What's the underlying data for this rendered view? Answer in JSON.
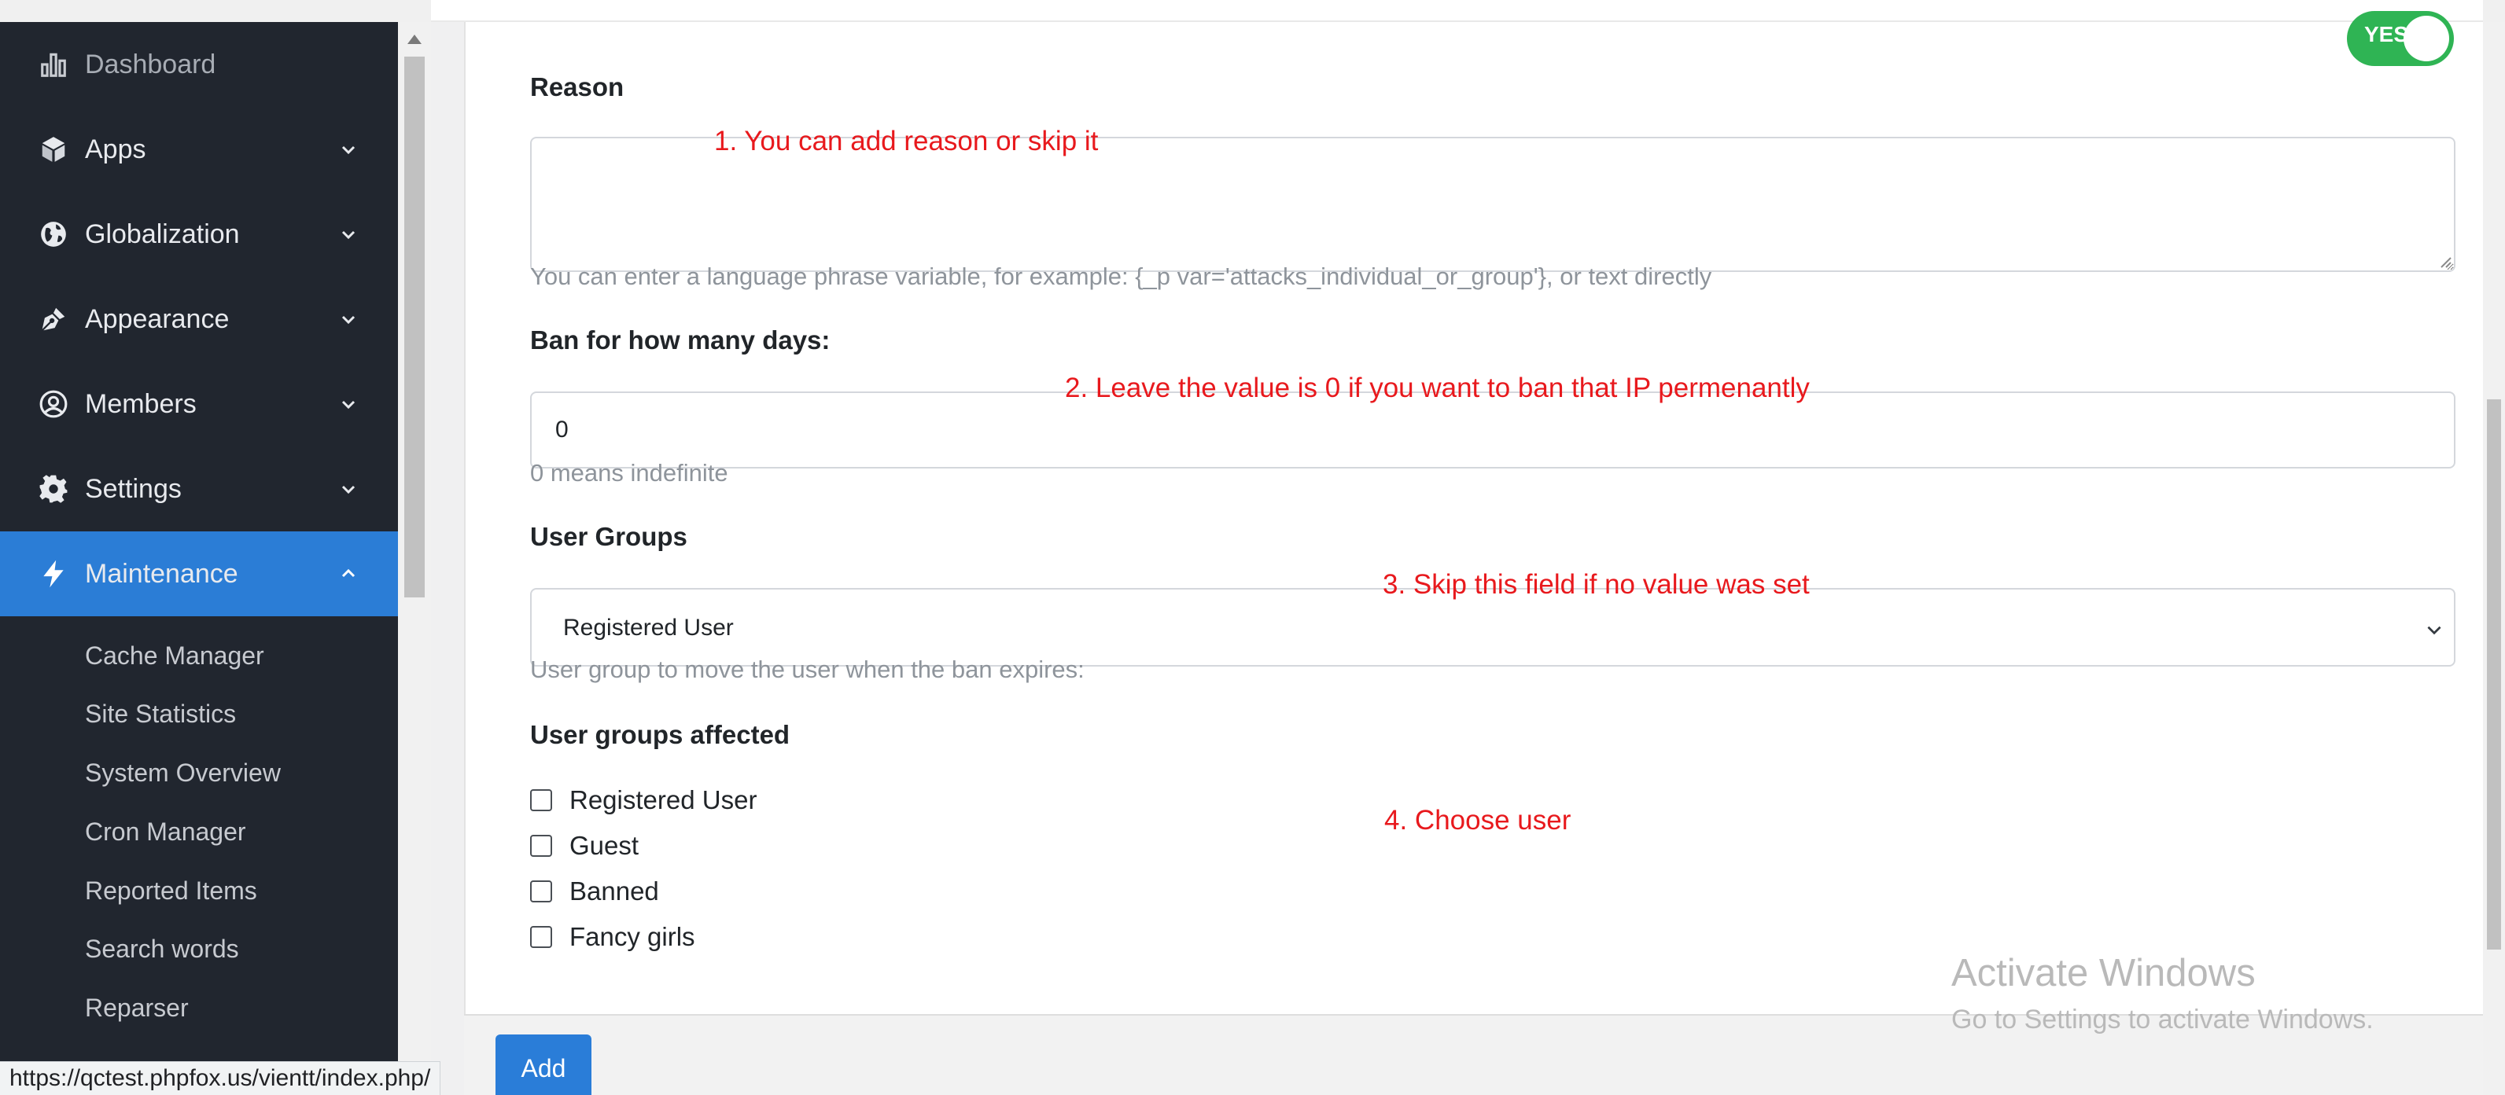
{
  "sidebar": {
    "items": [
      {
        "label": "Dashboard",
        "icon": "bar-chart-icon"
      },
      {
        "label": "Apps",
        "icon": "cube-icon"
      },
      {
        "label": "Globalization",
        "icon": "globe-icon"
      },
      {
        "label": "Appearance",
        "icon": "pen-nib-icon"
      },
      {
        "label": "Members",
        "icon": "user-circle-icon"
      },
      {
        "label": "Settings",
        "icon": "gear-icon"
      },
      {
        "label": "Maintenance",
        "icon": "bolt-icon"
      }
    ],
    "maintenance_subitems": [
      "Cache Manager",
      "Site Statistics",
      "System Overview",
      "Cron Manager",
      "Reported Items",
      "Search words",
      "Reparser"
    ],
    "active_color": "#2b7dd6"
  },
  "form": {
    "toggle_label": "YES",
    "toggle_state": "on",
    "reason": {
      "label": "Reason",
      "value": "",
      "help": "You can enter a language phrase variable, for example: {_p var='attacks_individual_or_group'}, or text directly"
    },
    "ban_days": {
      "label": "Ban for how many days:",
      "value": "0",
      "help": "0 means indefinite"
    },
    "user_groups": {
      "label": "User Groups",
      "selected": "Registered User",
      "help": "User group to move the user when the ban expires:"
    },
    "affected": {
      "label": "User groups affected",
      "options": [
        {
          "label": "Registered User",
          "checked": false
        },
        {
          "label": "Guest",
          "checked": false
        },
        {
          "label": "Banned",
          "checked": false
        },
        {
          "label": "Fancy girls",
          "checked": false
        }
      ]
    },
    "submit_label": "Add"
  },
  "annotations": [
    "1. You can add reason or skip it",
    "2. Leave the value is 0 if you want to ban that IP permenantly",
    "3. Skip this field if no value was set",
    "4. Choose user"
  ],
  "watermark": {
    "title": "Activate Windows",
    "subtitle": "Go to Settings to activate Windows."
  },
  "status_url": "https://qctest.phpfox.us/vientt/index.php/",
  "colors": {
    "sidebar_bg": "#21262f",
    "accent": "#2b7dd6",
    "annotation": "#e8191d",
    "toggle_on": "#2fb454",
    "button": "#2a7dd8"
  }
}
